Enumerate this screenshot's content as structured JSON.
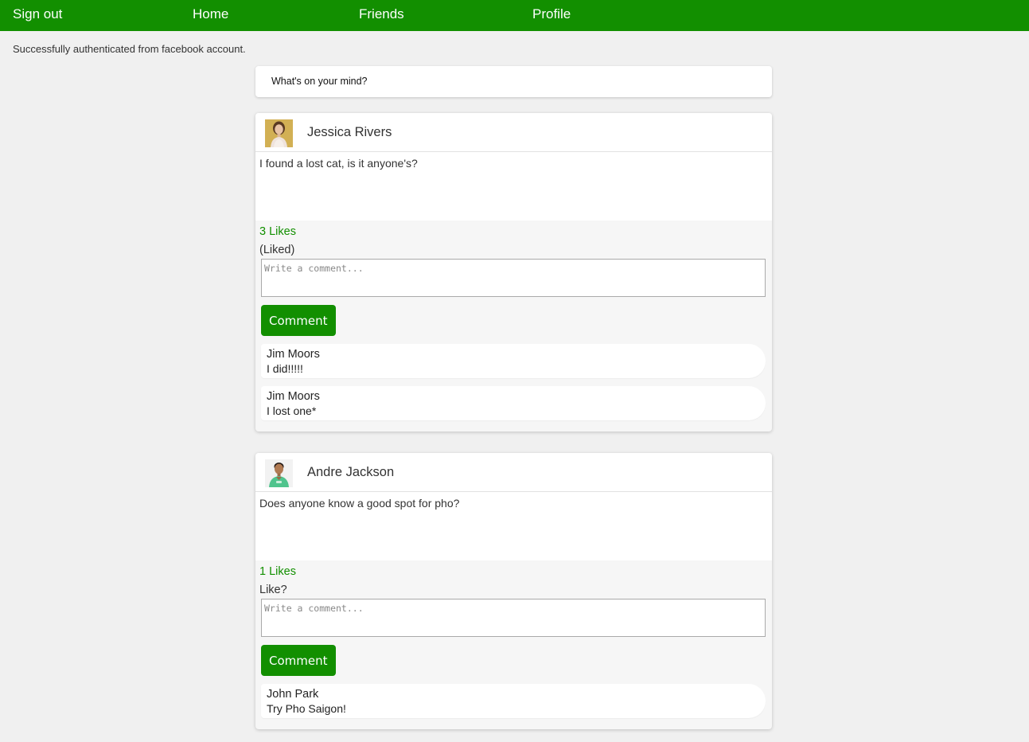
{
  "nav": {
    "sign_out": "Sign out",
    "home": "Home",
    "friends": "Friends",
    "profile": "Profile"
  },
  "flash": "Successfully authenticated from facebook account.",
  "composer": {
    "prompt": "What's on your mind?"
  },
  "posts": [
    {
      "author": "Jessica Rivers",
      "body": "I found a lost cat, is it anyone's?",
      "likes": "3 Likes",
      "like_state": "(Liked)",
      "comment_placeholder": "Write a comment...",
      "comment_button": "Comment",
      "comments": [
        {
          "author": "Jim Moors",
          "text": "I did!!!!!"
        },
        {
          "author": "Jim Moors",
          "text": "I lost one*"
        }
      ]
    },
    {
      "author": "Andre Jackson",
      "body": "Does anyone know a good spot for pho?",
      "likes": "1 Likes",
      "like_state": "Like?",
      "comment_placeholder": "Write a comment...",
      "comment_button": "Comment",
      "comments": [
        {
          "author": "John Park",
          "text": "Try Pho Saigon!"
        }
      ]
    }
  ],
  "colors": {
    "brand": "#128f00",
    "background": "#f0f0f0"
  }
}
